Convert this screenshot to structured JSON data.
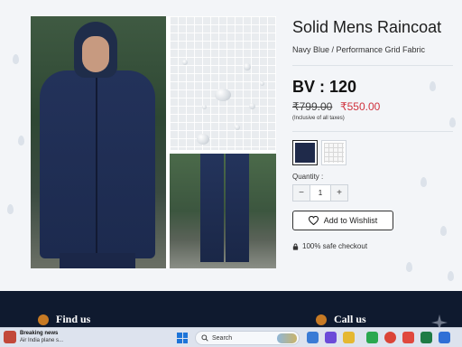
{
  "product": {
    "title": "Solid Mens Raincoat",
    "subtitle": "Navy Blue / Performance Grid Fabric",
    "bv": "BV : 120",
    "mrp": "₹799.00",
    "sale_price": "₹550.00",
    "tax_note": "(Inclusive of all taxes)",
    "variants": [
      {
        "name": "Navy Blue",
        "color": "#1f2a4a",
        "selected": true
      },
      {
        "name": "White Grid",
        "color": "#f7f7f7",
        "selected": false
      }
    ],
    "quantity_label": "Quantity :",
    "quantity": "1",
    "decrement_symbol": "−",
    "increment_symbol": "+",
    "wishlist_label": "Add to Wishlist",
    "checkout_note": "100% safe checkout"
  },
  "footer": {
    "find_us": "Find us",
    "call_us": "Call us"
  },
  "taskbar": {
    "news_title": "Breaking news",
    "news_sub": "Air India plane s...",
    "search_placeholder": "Search"
  },
  "colors": {
    "sale": "#d0313d",
    "footer_bg": "#0f1a2f",
    "accent_icon": "#c77a24"
  },
  "icons": [
    "heart-icon",
    "lock-icon",
    "search-icon",
    "windows-start-icon",
    "location-icon",
    "phone-icon"
  ]
}
